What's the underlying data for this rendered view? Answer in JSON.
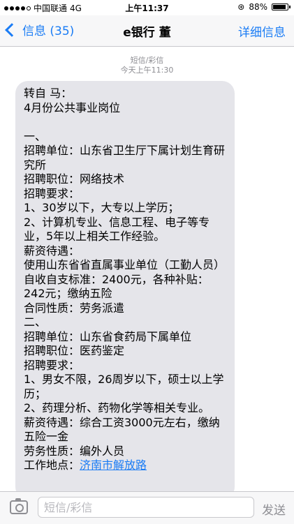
{
  "status_bar": {
    "carrier": "中国联通",
    "network": "4G",
    "time": "上午11:37",
    "battery_text": "88%",
    "battery_level": 0.88,
    "signal_bars_filled": 4,
    "signal_bars_total": 5
  },
  "nav": {
    "back_label": "信息 (35)",
    "title": "e银行 董",
    "details_label": "详细信息"
  },
  "thread": {
    "service_label": "短信/彩信",
    "timestamp": "今天上午11:30",
    "message_text": "转自 马：\n4月份公共事业岗位\n\n一、\n招聘单位：山东省卫生厅下属计划生育研究所\n招聘职位：网络技术\n招聘要求：\n1、30岁以下，大专以上学历；\n2、计算机专业、信息工程、电子等专业，5年以上相关工作经验。\n薪资待遇：\n使用山东省省直属事业单位（工勤人员）自收自支标准：2400元，各种补贴：242元；缴纳五险\n合同性质：劳务派遣\n二、\n招聘单位：山东省食药局下属单位\n招聘职位：医药鉴定\n招聘要求：\n1、男女不限，26周岁以下，硕士以上学历；\n2、药理分析、药物化学等相关专业。\n薪资待遇：综合工资3000元左右，缴纳五险一金\n劳务性质：编外人员\n工作地点：",
    "link_text": "济南市解放路"
  },
  "input_bar": {
    "placeholder": "短信/彩信",
    "send_label": "发送"
  },
  "colors": {
    "accent": "#1a7cf5",
    "bubble": "#e5e5ea",
    "bar_bg": "#f7f7f8"
  }
}
